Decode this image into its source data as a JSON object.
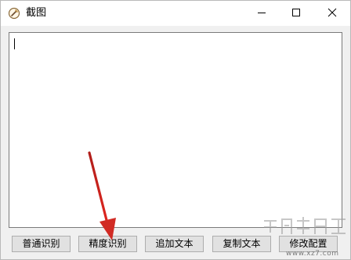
{
  "window": {
    "title": "截图",
    "icon": "app-icon",
    "controls": {
      "minimize_icon": "minimize-icon",
      "maximize_icon": "maximize-icon",
      "close_icon": "close-icon"
    }
  },
  "editor": {
    "value": ""
  },
  "buttons": {
    "normal_ocr": "普通识别",
    "precise_ocr": "精度识别",
    "append_text": "追加文本",
    "copy_text": "复制文本",
    "edit_config": "修改配置"
  },
  "annotation": {
    "color": "#d12b24"
  },
  "watermark": {
    "text": "www.xz7.com"
  }
}
